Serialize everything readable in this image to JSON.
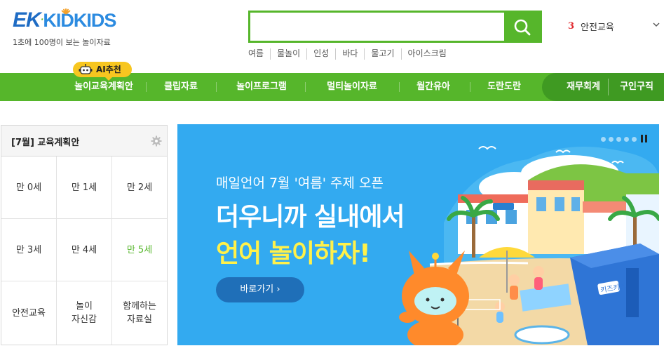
{
  "header": {
    "logo_ek": "EK",
    "logo_kids": "KIDKIDS",
    "tagline": "1초에 100명이 보는 놀이자료"
  },
  "search": {
    "value": "",
    "placeholder": "",
    "keywords": [
      "여름",
      "물놀이",
      "인성",
      "바다",
      "물고기",
      "아이스크림"
    ]
  },
  "ranking": {
    "number": "3",
    "label": "안전교육"
  },
  "ai_badge": "AI추천",
  "nav": {
    "items": [
      "놀이교육계획안",
      "클립자료",
      "놀이프로그램",
      "멀티놀이자료",
      "월간유아",
      "도란도란"
    ],
    "extra": [
      "재무회계",
      "구인구직"
    ]
  },
  "plan": {
    "title": "[7월] 교육계획안",
    "cells": [
      [
        "만 0세",
        "만 1세",
        "만 2세"
      ],
      [
        "만 3세",
        "만 4세",
        "만 5세"
      ],
      [
        "안전교육",
        "놀이\n자신감",
        "함께하는\n자료실"
      ]
    ],
    "active_cell": "만 5세"
  },
  "banner": {
    "subtitle": "매일언어 7월 '여름' 주제 오픈",
    "line1": "더우니까 실내에서",
    "line2": "언어 놀이하자!",
    "button": "바로가기",
    "building_sign": "키즈키즈",
    "accent": "#fff14a"
  },
  "colors": {
    "brand_green": "#56b62b",
    "banner_blue": "#33aaf0",
    "rank_red": "#e0262c"
  }
}
